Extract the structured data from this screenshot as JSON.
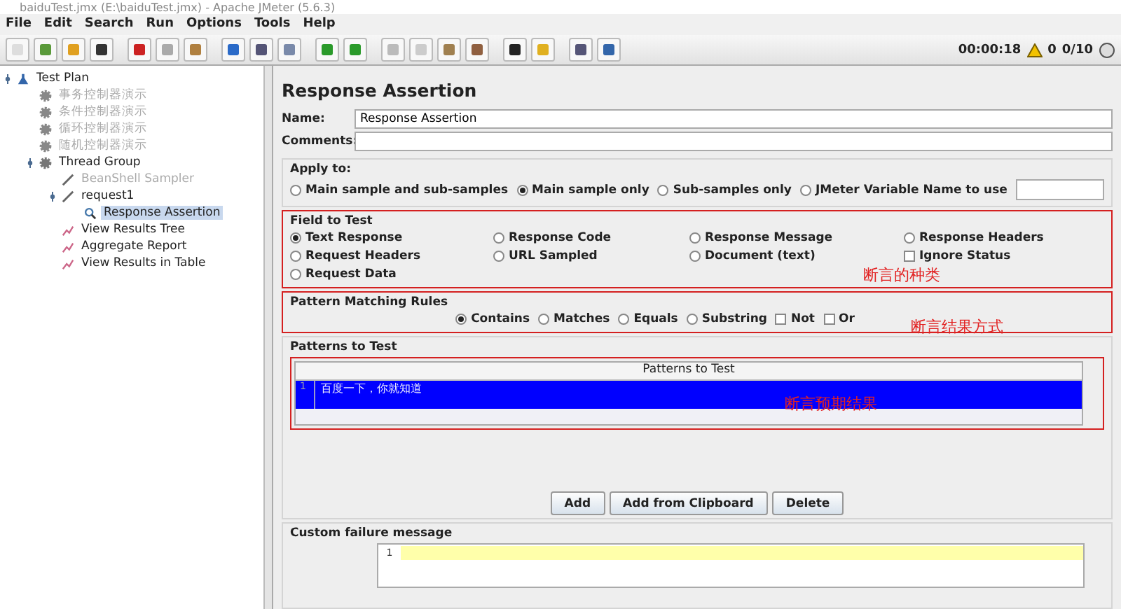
{
  "window": {
    "title": "baiduTest.jmx (E:\\baiduTest.jmx) - Apache JMeter (5.6.3)"
  },
  "menu": [
    "File",
    "Edit",
    "Search",
    "Run",
    "Options",
    "Tools",
    "Help"
  ],
  "status": {
    "timer": "00:00:18",
    "warnings": "0",
    "threads": "0/10"
  },
  "tree": [
    {
      "label": "Test Plan",
      "kind": "plan",
      "disabled": false,
      "selected": false,
      "children": [
        {
          "label": "事务控制器演示",
          "kind": "controller",
          "disabled": true,
          "selected": false
        },
        {
          "label": "条件控制器演示",
          "kind": "controller",
          "disabled": true,
          "selected": false
        },
        {
          "label": "循环控制器演示",
          "kind": "controller",
          "disabled": true,
          "selected": false
        },
        {
          "label": "随机控制器演示",
          "kind": "controller",
          "disabled": true,
          "selected": false
        },
        {
          "label": "Thread Group",
          "kind": "thread",
          "disabled": false,
          "selected": false,
          "children": [
            {
              "label": "BeanShell Sampler",
              "kind": "sampler",
              "disabled": true,
              "selected": false
            },
            {
              "label": "request1",
              "kind": "sampler",
              "disabled": false,
              "selected": false,
              "children": [
                {
                  "label": "Response Assertion",
                  "kind": "assertion",
                  "disabled": false,
                  "selected": true
                }
              ]
            },
            {
              "label": "View Results Tree",
              "kind": "listener",
              "disabled": false,
              "selected": false
            },
            {
              "label": "Aggregate Report",
              "kind": "listener",
              "disabled": false,
              "selected": false
            },
            {
              "label": "View Results in Table",
              "kind": "listener",
              "disabled": false,
              "selected": false
            }
          ]
        }
      ]
    }
  ],
  "panel": {
    "title": "Response Assertion",
    "name_label": "Name:",
    "name_value": "Response Assertion",
    "comments_label": "Comments:"
  },
  "apply_to": {
    "title": "Apply to:",
    "options": [
      {
        "label": "Main sample and sub-samples",
        "selected": false
      },
      {
        "label": "Main sample only",
        "selected": true
      },
      {
        "label": "Sub-samples only",
        "selected": false
      },
      {
        "label": "JMeter Variable Name to use",
        "selected": false
      }
    ]
  },
  "field_to_test": {
    "title": "Field to Test",
    "annotation": "断言的种类",
    "options": [
      {
        "label": "Text Response",
        "kind": "radio",
        "selected": true
      },
      {
        "label": "Response Code",
        "kind": "radio",
        "selected": false
      },
      {
        "label": "Response Message",
        "kind": "radio",
        "selected": false
      },
      {
        "label": "Response Headers",
        "kind": "radio",
        "selected": false
      },
      {
        "label": "Request Headers",
        "kind": "radio",
        "selected": false
      },
      {
        "label": "URL Sampled",
        "kind": "radio",
        "selected": false
      },
      {
        "label": "Document (text)",
        "kind": "radio",
        "selected": false
      },
      {
        "label": "Ignore Status",
        "kind": "checkbox",
        "selected": false
      },
      {
        "label": "Request Data",
        "kind": "radio",
        "selected": false
      }
    ]
  },
  "pattern_matching": {
    "title": "Pattern Matching Rules",
    "annotation": "断言结果方式",
    "options": [
      {
        "label": "Contains",
        "kind": "radio",
        "selected": true
      },
      {
        "label": "Matches",
        "kind": "radio",
        "selected": false
      },
      {
        "label": "Equals",
        "kind": "radio",
        "selected": false
      },
      {
        "label": "Substring",
        "kind": "radio",
        "selected": false
      },
      {
        "label": "Not",
        "kind": "checkbox",
        "selected": false
      },
      {
        "label": "Or",
        "kind": "checkbox",
        "selected": false
      }
    ]
  },
  "patterns": {
    "title": "Patterns to Test",
    "column": "Patterns to Test",
    "annotation": "断言预期结果",
    "rows": [
      {
        "number": "1",
        "value": "百度一下，你就知道",
        "selected": true
      }
    ]
  },
  "buttons": [
    "Add",
    "Add from Clipboard",
    "Delete"
  ],
  "failure": {
    "title": "Custom failure message",
    "line": "1"
  }
}
